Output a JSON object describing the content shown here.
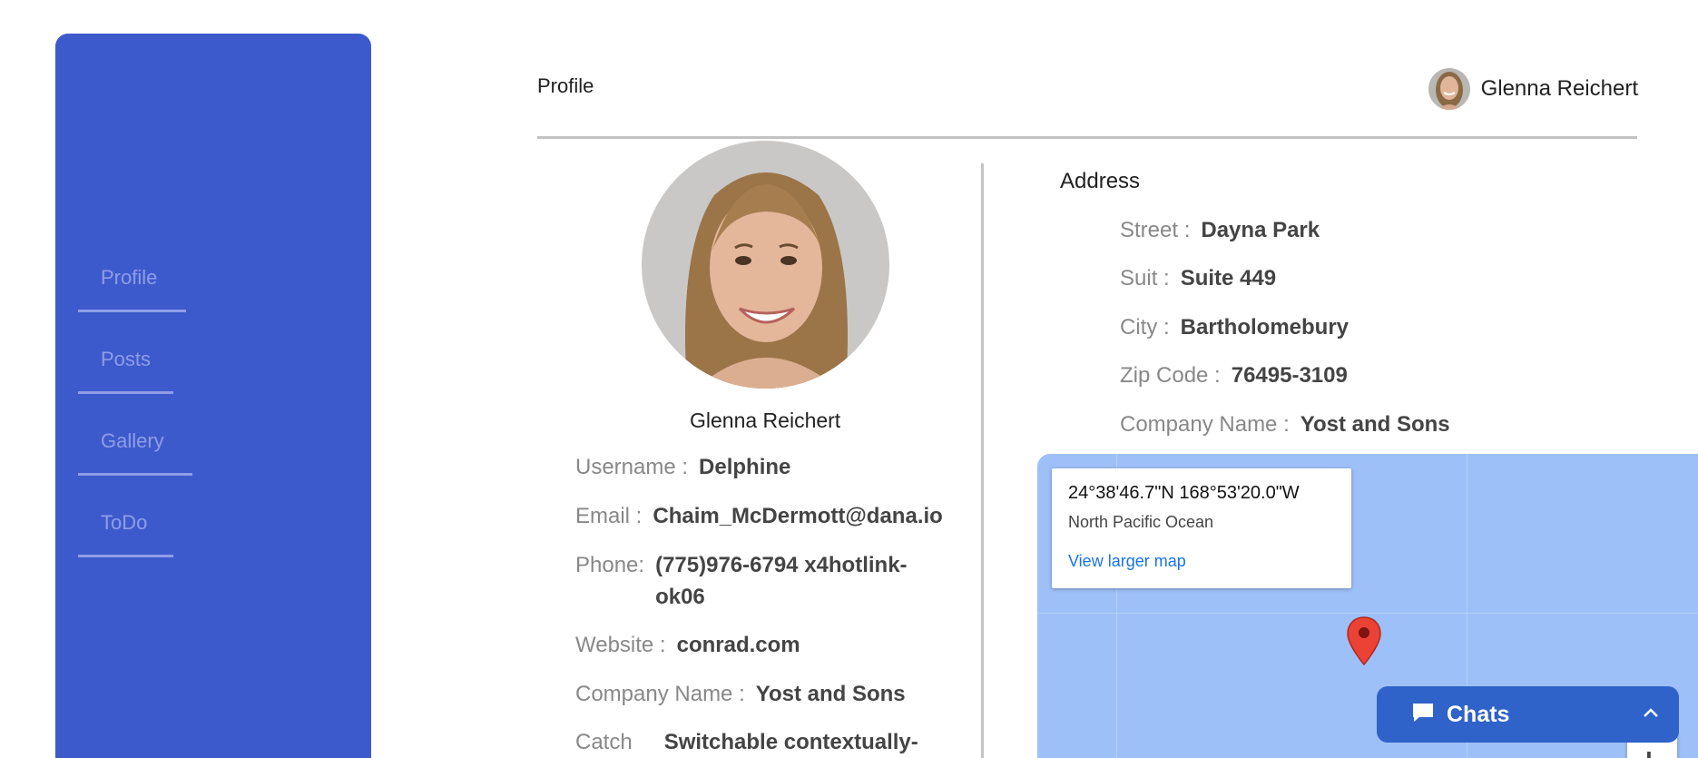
{
  "sidebar": {
    "items": [
      {
        "label": "Profile"
      },
      {
        "label": "Posts"
      },
      {
        "label": "Gallery"
      },
      {
        "label": "ToDo"
      }
    ]
  },
  "header": {
    "title": "Profile",
    "user_name": "Glenna Reichert"
  },
  "profile": {
    "name": "Glenna Reichert",
    "fields": [
      {
        "label": "Username :",
        "value": "Delphine"
      },
      {
        "label": "Email :",
        "value": "Chaim_McDermott@dana.io"
      },
      {
        "label": "Phone:",
        "value": "(775)976-6794 x4hotlink-ok06"
      },
      {
        "label": "Website :",
        "value": "conrad.com"
      },
      {
        "label": "Company Name :",
        "value": "Yost and Sons"
      },
      {
        "label": "Catch",
        "value": "Switchable contextually-"
      }
    ]
  },
  "address": {
    "title": "Address",
    "fields": [
      {
        "label": "Street :",
        "value": "Dayna Park"
      },
      {
        "label": "Suit :",
        "value": "Suite 449"
      },
      {
        "label": "City :",
        "value": "Bartholomebury"
      },
      {
        "label": "Zip Code :",
        "value": "76495-3109"
      },
      {
        "label": "Company Name :",
        "value": "Yost and Sons"
      }
    ]
  },
  "map": {
    "coords": "24°38'46.7\"N 168°53'20.0\"W",
    "place": "North Pacific Ocean",
    "link_label": "View larger map",
    "zoom_in_glyph": "+"
  },
  "chats": {
    "label": "Chats"
  },
  "colors": {
    "sidebar_bg": "#3d5acc",
    "nav_text": "#8f9de8",
    "map_water": "#9ec0f8",
    "chat_bg": "#2f63c9",
    "link": "#1a73e8",
    "pin": "#ea4335"
  },
  "icons": {
    "chat": "chat-bubble-icon",
    "collapse": "chevron-up-icon",
    "pin": "map-pin-icon"
  }
}
